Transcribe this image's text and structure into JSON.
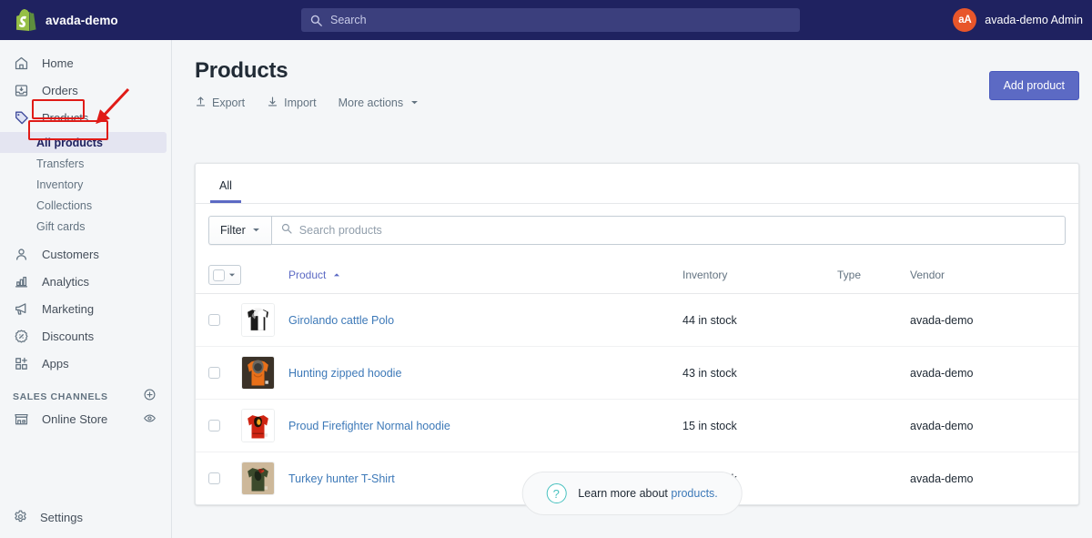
{
  "topbar": {
    "store_name": "avada-demo",
    "logo_icon": "shopify-bag-icon",
    "search": {
      "placeholder": "Search",
      "icon": "search-icon"
    },
    "user": {
      "initials": "aA",
      "name": "avada-demo Admin"
    },
    "colors": {
      "bar_bg": "#1f2260",
      "search_bg": "#3b3f7d",
      "avatar_bg": "#e8562a"
    }
  },
  "sidebar": {
    "items": [
      {
        "label": "Home",
        "icon": "home-icon"
      },
      {
        "label": "Orders",
        "icon": "orders-inbox-icon"
      },
      {
        "label": "Products",
        "icon": "product-tag-icon",
        "active": true
      },
      {
        "label": "Customers",
        "icon": "customer-person-icon"
      },
      {
        "label": "Analytics",
        "icon": "analytics-bars-icon"
      },
      {
        "label": "Marketing",
        "icon": "marketing-megaphone-icon"
      },
      {
        "label": "Discounts",
        "icon": "discount-badge-icon"
      },
      {
        "label": "Apps",
        "icon": "apps-grid-plus-icon"
      }
    ],
    "sub_items": [
      {
        "label": "All products",
        "active": true
      },
      {
        "label": "Transfers",
        "active": false
      },
      {
        "label": "Inventory",
        "active": false
      },
      {
        "label": "Collections",
        "active": false
      },
      {
        "label": "Gift cards",
        "active": false
      }
    ],
    "sales_channels": {
      "heading": "SALES CHANNELS",
      "add_icon": "plus-circle-icon",
      "items": [
        {
          "label": "Online Store",
          "icon": "storefront-icon",
          "trailing_icon": "eye-icon"
        }
      ]
    },
    "settings": {
      "label": "Settings",
      "icon": "gear-icon"
    }
  },
  "page": {
    "title": "Products",
    "actions": [
      {
        "label": "Export",
        "icon": "export-up-icon"
      },
      {
        "label": "Import",
        "icon": "import-down-icon"
      },
      {
        "label": "More actions",
        "icon": "chevron-down-icon"
      }
    ],
    "primary_button": {
      "label": "Add product",
      "color": "#5c6ac4"
    }
  },
  "card": {
    "tabs": [
      {
        "label": "All",
        "active": true
      }
    ],
    "filter_button": {
      "label": "Filter",
      "icon": "chevron-down-icon"
    },
    "search": {
      "placeholder": "Search products",
      "value": "",
      "icon": "search-icon"
    },
    "table": {
      "columns": [
        "Product",
        "Inventory",
        "Type",
        "Vendor"
      ],
      "sort": {
        "column": "Product",
        "direction": "ascending",
        "icon": "caret-up-icon"
      },
      "select_all": {
        "checked": false,
        "icon": "checkbox-dropdown-icon"
      },
      "rows": [
        {
          "checked": false,
          "thumb": "polo-shirt-thumbnail",
          "name": "Girolando cattle Polo",
          "inventory": "44 in stock",
          "type": "",
          "vendor": "avada-demo"
        },
        {
          "checked": false,
          "thumb": "hunting-hoodie-thumbnail",
          "name": "Hunting zipped hoodie",
          "inventory": "43 in stock",
          "type": "",
          "vendor": "avada-demo"
        },
        {
          "checked": false,
          "thumb": "firefighter-hoodie-thumbnail",
          "name": "Proud Firefighter Normal hoodie",
          "inventory": "15 in stock",
          "type": "",
          "vendor": "avada-demo"
        },
        {
          "checked": false,
          "thumb": "turkey-hunter-tshirt-thumbnail",
          "name": "Turkey hunter T-Shirt",
          "inventory": "13 in stock",
          "type": "",
          "vendor": "avada-demo"
        }
      ]
    }
  },
  "footer_help": {
    "icon": "question-mark-circle-icon",
    "text": "Learn more about ",
    "link": "products.",
    "accent": "#47c1bf"
  },
  "annotations": {
    "color": "#e01b17",
    "boxes": [
      {
        "target": "sidebar-item-products"
      },
      {
        "target": "sidebar-subitem-all-products"
      }
    ],
    "arrow": {
      "from": "upper-right",
      "to": "sidebar-subitem-all-products"
    }
  }
}
